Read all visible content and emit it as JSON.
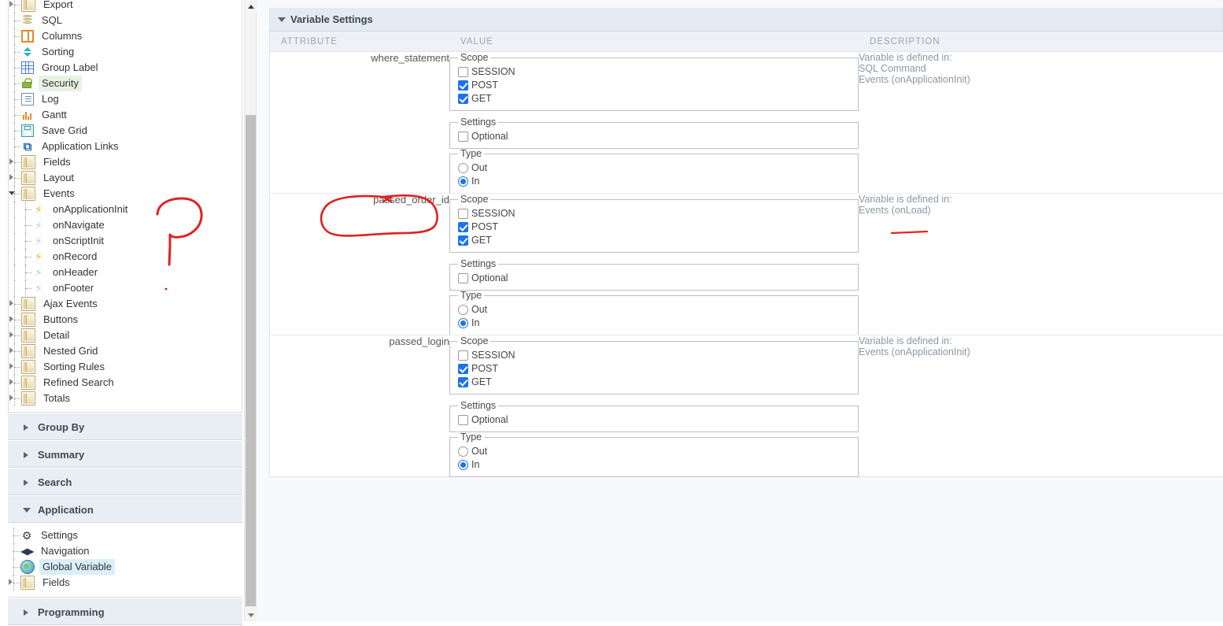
{
  "sidebar": {
    "tree_items": [
      {
        "label": "Export",
        "icon": "folder-icon",
        "indent": 1,
        "expander": "closed",
        "clipped": true
      },
      {
        "label": "SQL",
        "icon": "sql-icon",
        "indent": 1,
        "expander": "none"
      },
      {
        "label": "Columns",
        "icon": "columns-icon",
        "indent": 1,
        "expander": "none"
      },
      {
        "label": "Sorting",
        "icon": "sorting-icon",
        "indent": 1,
        "expander": "none"
      },
      {
        "label": "Group Label",
        "icon": "grid-icon",
        "indent": 1,
        "expander": "none"
      },
      {
        "label": "Security",
        "icon": "lock-icon",
        "indent": 1,
        "expander": "none",
        "selected": "green"
      },
      {
        "label": "Log",
        "icon": "log-icon",
        "indent": 1,
        "expander": "none"
      },
      {
        "label": "Gantt",
        "icon": "gantt-icon",
        "indent": 1,
        "expander": "none"
      },
      {
        "label": "Save Grid",
        "icon": "save-icon",
        "indent": 1,
        "expander": "none"
      },
      {
        "label": "Application Links",
        "icon": "link-icon",
        "indent": 1,
        "expander": "none"
      },
      {
        "label": "Fields",
        "icon": "folder-icon",
        "indent": 1,
        "expander": "closed"
      },
      {
        "label": "Layout",
        "icon": "folder-icon",
        "indent": 1,
        "expander": "closed"
      },
      {
        "label": "Events",
        "icon": "folder-icon",
        "indent": 1,
        "expander": "open"
      },
      {
        "label": "onApplicationInit",
        "icon": "bolt-icon",
        "indent": 2,
        "expander": "none"
      },
      {
        "label": "onNavigate",
        "icon": "bolt-dim-icon",
        "indent": 2,
        "expander": "none"
      },
      {
        "label": "onScriptInit",
        "icon": "bolt-dim-icon",
        "indent": 2,
        "expander": "none"
      },
      {
        "label": "onRecord",
        "icon": "bolt-icon",
        "indent": 2,
        "expander": "none"
      },
      {
        "label": "onHeader",
        "icon": "bolt-dim-icon",
        "indent": 2,
        "expander": "none"
      },
      {
        "label": "onFooter",
        "icon": "bolt-dim-icon",
        "indent": 2,
        "expander": "none"
      },
      {
        "label": "Ajax Events",
        "icon": "folder-icon",
        "indent": 1,
        "expander": "closed"
      },
      {
        "label": "Buttons",
        "icon": "folder-icon",
        "indent": 1,
        "expander": "closed"
      },
      {
        "label": "Detail",
        "icon": "folder-icon",
        "indent": 1,
        "expander": "closed"
      },
      {
        "label": "Nested Grid",
        "icon": "folder-icon",
        "indent": 1,
        "expander": "closed"
      },
      {
        "label": "Sorting Rules",
        "icon": "folder-icon",
        "indent": 1,
        "expander": "closed"
      },
      {
        "label": "Refined Search",
        "icon": "folder-icon",
        "indent": 1,
        "expander": "closed"
      },
      {
        "label": "Totals",
        "icon": "folder-icon",
        "indent": 1,
        "expander": "closed"
      }
    ],
    "sections": [
      {
        "label": "Group By",
        "open": false
      },
      {
        "label": "Summary",
        "open": false
      },
      {
        "label": "Search",
        "open": false
      },
      {
        "label": "Application",
        "open": true,
        "items": [
          {
            "label": "Settings",
            "icon": "gear-icon",
            "expander": "none"
          },
          {
            "label": "Navigation",
            "icon": "navigation-icon",
            "expander": "none"
          },
          {
            "label": "Global Variable",
            "icon": "globe-icon",
            "expander": "none",
            "selected": "blue"
          },
          {
            "label": "Fields",
            "icon": "folder-icon",
            "expander": "closed"
          }
        ]
      },
      {
        "label": "Programming",
        "open": false
      }
    ]
  },
  "panel": {
    "title": "Variable Settings",
    "columns": {
      "attribute": "ATTRIBUTE",
      "value": "VALUE",
      "description": "DESCRIPTION"
    },
    "rows": [
      {
        "attribute": "where_statement",
        "scope": {
          "legend": "Scope",
          "options": [
            {
              "label": "SESSION",
              "checked": false
            },
            {
              "label": "POST",
              "checked": true
            },
            {
              "label": "GET",
              "checked": true
            }
          ]
        },
        "settings": {
          "legend": "Settings",
          "options": [
            {
              "label": "Optional",
              "checked": false
            }
          ]
        },
        "type": {
          "legend": "Type",
          "options": [
            {
              "label": "Out",
              "selected": false
            },
            {
              "label": "In",
              "selected": true
            }
          ]
        },
        "description": [
          "Variable is defined in:",
          "SQL Command",
          "Events (onApplicationInit)"
        ]
      },
      {
        "attribute": "passed_order_id",
        "scope": {
          "legend": "Scope",
          "options": [
            {
              "label": "SESSION",
              "checked": false
            },
            {
              "label": "POST",
              "checked": true
            },
            {
              "label": "GET",
              "checked": true
            }
          ]
        },
        "settings": {
          "legend": "Settings",
          "options": [
            {
              "label": "Optional",
              "checked": false
            }
          ]
        },
        "type": {
          "legend": "Type",
          "options": [
            {
              "label": "Out",
              "selected": false
            },
            {
              "label": "In",
              "selected": true
            }
          ]
        },
        "description": [
          "Variable is defined in:",
          "Events (onLoad)"
        ]
      },
      {
        "attribute": "passed_login",
        "scope": {
          "legend": "Scope",
          "options": [
            {
              "label": "SESSION",
              "checked": false
            },
            {
              "label": "POST",
              "checked": true
            },
            {
              "label": "GET",
              "checked": true
            }
          ]
        },
        "settings": {
          "legend": "Settings",
          "options": [
            {
              "label": "Optional",
              "checked": false
            }
          ]
        },
        "type": {
          "legend": "Type",
          "options": [
            {
              "label": "Out",
              "selected": false
            },
            {
              "label": "In",
              "selected": true
            }
          ]
        },
        "description": [
          "Variable is defined in:",
          "Events (onApplicationInit)"
        ]
      }
    ]
  },
  "annotations": {
    "color": "#e02020",
    "shapes": [
      {
        "name": "hand-drawn-hook-near-events",
        "kind": "hook"
      },
      {
        "name": "hand-drawn-oval-around-passed-order-id",
        "kind": "oval"
      },
      {
        "name": "hand-drawn-underline-under-onload",
        "kind": "underline"
      }
    ]
  },
  "scrollbar": {
    "up_arrow": "scroll-up-arrow",
    "down_arrow": "scroll-down-arrow"
  }
}
